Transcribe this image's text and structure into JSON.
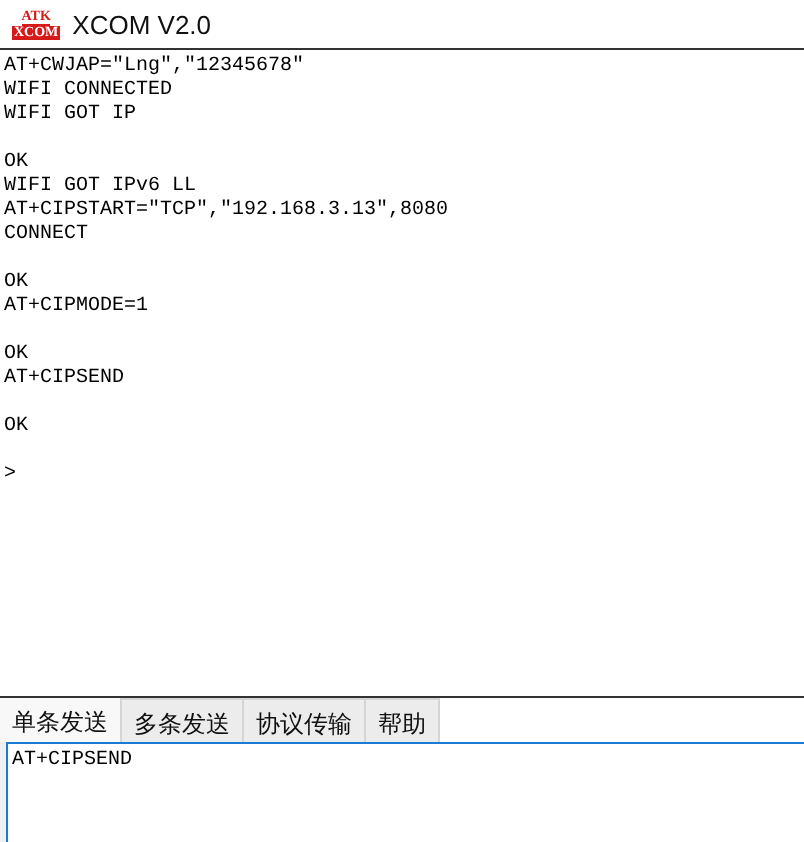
{
  "window": {
    "logo": [
      "ATK",
      "XCOM"
    ],
    "title": "XCOM V2.0"
  },
  "receive_area": {
    "blocks": [
      [
        "AT+CWJAP=\"Lng\",\"12345678\"",
        "WIFI CONNECTED",
        "WIFI GOT IP"
      ],
      [
        "OK",
        "WIFI GOT IPv6 LL",
        "AT+CIPSTART=\"TCP\",\"192.168.3.13\",8080",
        "CONNECT"
      ],
      [
        "OK",
        "AT+CIPMODE=1"
      ],
      [
        "OK",
        "AT+CIPSEND"
      ],
      [
        "OK"
      ],
      [
        ">"
      ]
    ]
  },
  "tabs": [
    {
      "label": "单条发送",
      "selected": true
    },
    {
      "label": "多条发送",
      "selected": false
    },
    {
      "label": "协议传输",
      "selected": false
    },
    {
      "label": "帮助",
      "selected": false
    }
  ],
  "send_field": {
    "value": "AT+CIPSEND"
  }
}
